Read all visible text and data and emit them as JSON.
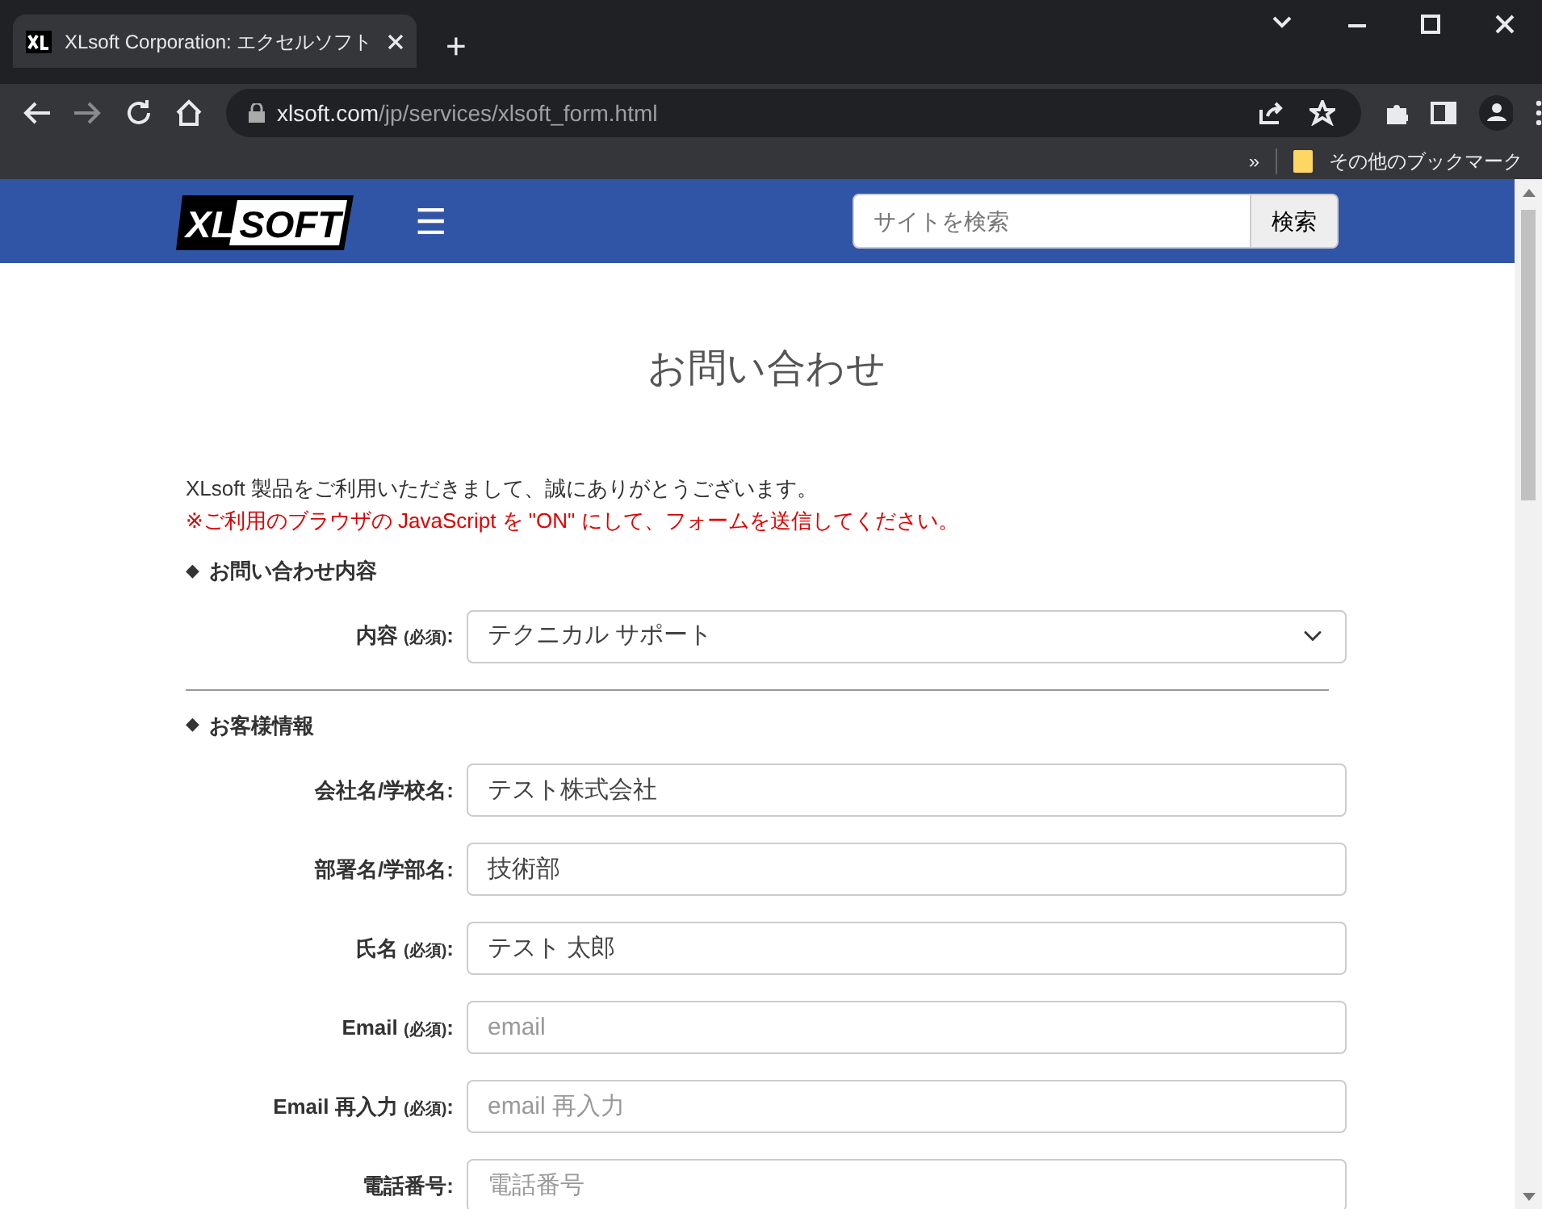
{
  "browser": {
    "tab": {
      "title": "XLsoft Corporation: エクセルソフト",
      "selected": true
    },
    "new_tab": "+",
    "url_host": "xlsoft.com",
    "url_path": "/jp/services/xlsoft_form.html",
    "bookmarks_more": "»",
    "bookmark_folder": "その他のブックマーク"
  },
  "site": {
    "logo": "XLSOFT",
    "menu": "☰",
    "search": {
      "placeholder": "サイトを検索",
      "button": "検索"
    }
  },
  "page": {
    "title": "お問い合わせ",
    "intro": "XLsoft 製品をご利用いただきまして、誠にありがとうございます。",
    "notice": "※ご利用のブラウザの JavaScript を \"ON\" にして、フォームを送信してください。",
    "sections": [
      {
        "heading": "お問い合わせ内容",
        "mark": "◆",
        "divider": true,
        "fields": [
          {
            "kind": "select",
            "label": "内容",
            "required_mark": "(必須)",
            "label_end": ":",
            "value": "テクニカル サポート"
          }
        ]
      },
      {
        "heading": "お客様情報",
        "mark": "◆",
        "divider": false,
        "fields": [
          {
            "kind": "text",
            "label": "会社名/学校名:",
            "value": "テスト株式会社"
          },
          {
            "kind": "text",
            "label": "部署名/学部名:",
            "value": "技術部"
          },
          {
            "kind": "text",
            "label": "氏名",
            "required_mark": "(必須)",
            "label_end": ":",
            "value": "テスト 太郎"
          },
          {
            "kind": "text",
            "label": "Email",
            "required_mark": "(必須)",
            "label_end": ":",
            "placeholder": "email"
          },
          {
            "kind": "text",
            "label": "Email 再入力",
            "required_mark": "(必須)",
            "label_end": ":",
            "placeholder": "email 再入力"
          },
          {
            "kind": "text",
            "label": "電話番号:",
            "placeholder": "電話番号"
          }
        ]
      }
    ]
  }
}
